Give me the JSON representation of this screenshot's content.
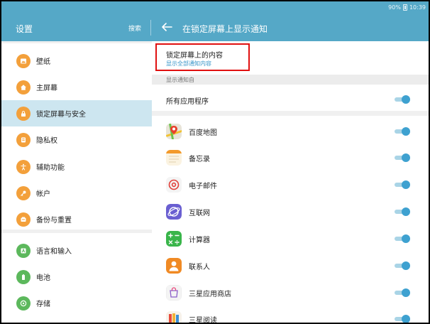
{
  "status_bar": {
    "battery": "90%",
    "time": "10:39"
  },
  "app_bar": {
    "left_title": "设置",
    "search_label": "搜索",
    "right_title": "在锁定屏幕上显示通知"
  },
  "sidebar": {
    "items": [
      {
        "label": "壁纸",
        "icon": "wallpaper-icon"
      },
      {
        "label": "主屏幕",
        "icon": "home-icon"
      },
      {
        "label": "锁定屏幕与安全",
        "icon": "lock-icon",
        "selected": true
      },
      {
        "label": "隐私权",
        "icon": "privacy-icon"
      },
      {
        "label": "辅助功能",
        "icon": "accessibility-icon"
      },
      {
        "label": "帐户",
        "icon": "key-icon"
      },
      {
        "label": "备份与重置",
        "icon": "backup-icon"
      },
      {
        "label": "语言和输入",
        "icon": "language-icon"
      },
      {
        "label": "电池",
        "icon": "battery-icon"
      },
      {
        "label": "存储",
        "icon": "storage-icon"
      }
    ]
  },
  "lock_content": {
    "title": "锁定屏幕上的内容",
    "subtitle": "显示全部通知内容"
  },
  "section_header": "显示通知自",
  "all_apps": {
    "label": "所有应用程序",
    "enabled": true
  },
  "apps": [
    {
      "label": "百度地图",
      "icon": "baidu-map-icon",
      "enabled": true
    },
    {
      "label": "备忘录",
      "icon": "memo-icon",
      "enabled": true
    },
    {
      "label": "电子邮件",
      "icon": "email-icon",
      "enabled": true
    },
    {
      "label": "互联网",
      "icon": "internet-icon",
      "enabled": true
    },
    {
      "label": "计算器",
      "icon": "calculator-icon",
      "enabled": true
    },
    {
      "label": "联系人",
      "icon": "contacts-icon",
      "enabled": true
    },
    {
      "label": "三星应用商店",
      "icon": "galaxy-apps-icon",
      "enabled": true
    },
    {
      "label": "三星阅读",
      "icon": "samsung-books-icon",
      "enabled": true
    }
  ],
  "colors": {
    "header": "#55a8c7",
    "accent": "#3ea1d0",
    "menu_icon": "#f3a03b",
    "menu_icon_green": "#5cb85c",
    "selected_bg": "#cde6f0",
    "highlight_box": "#e01010"
  }
}
